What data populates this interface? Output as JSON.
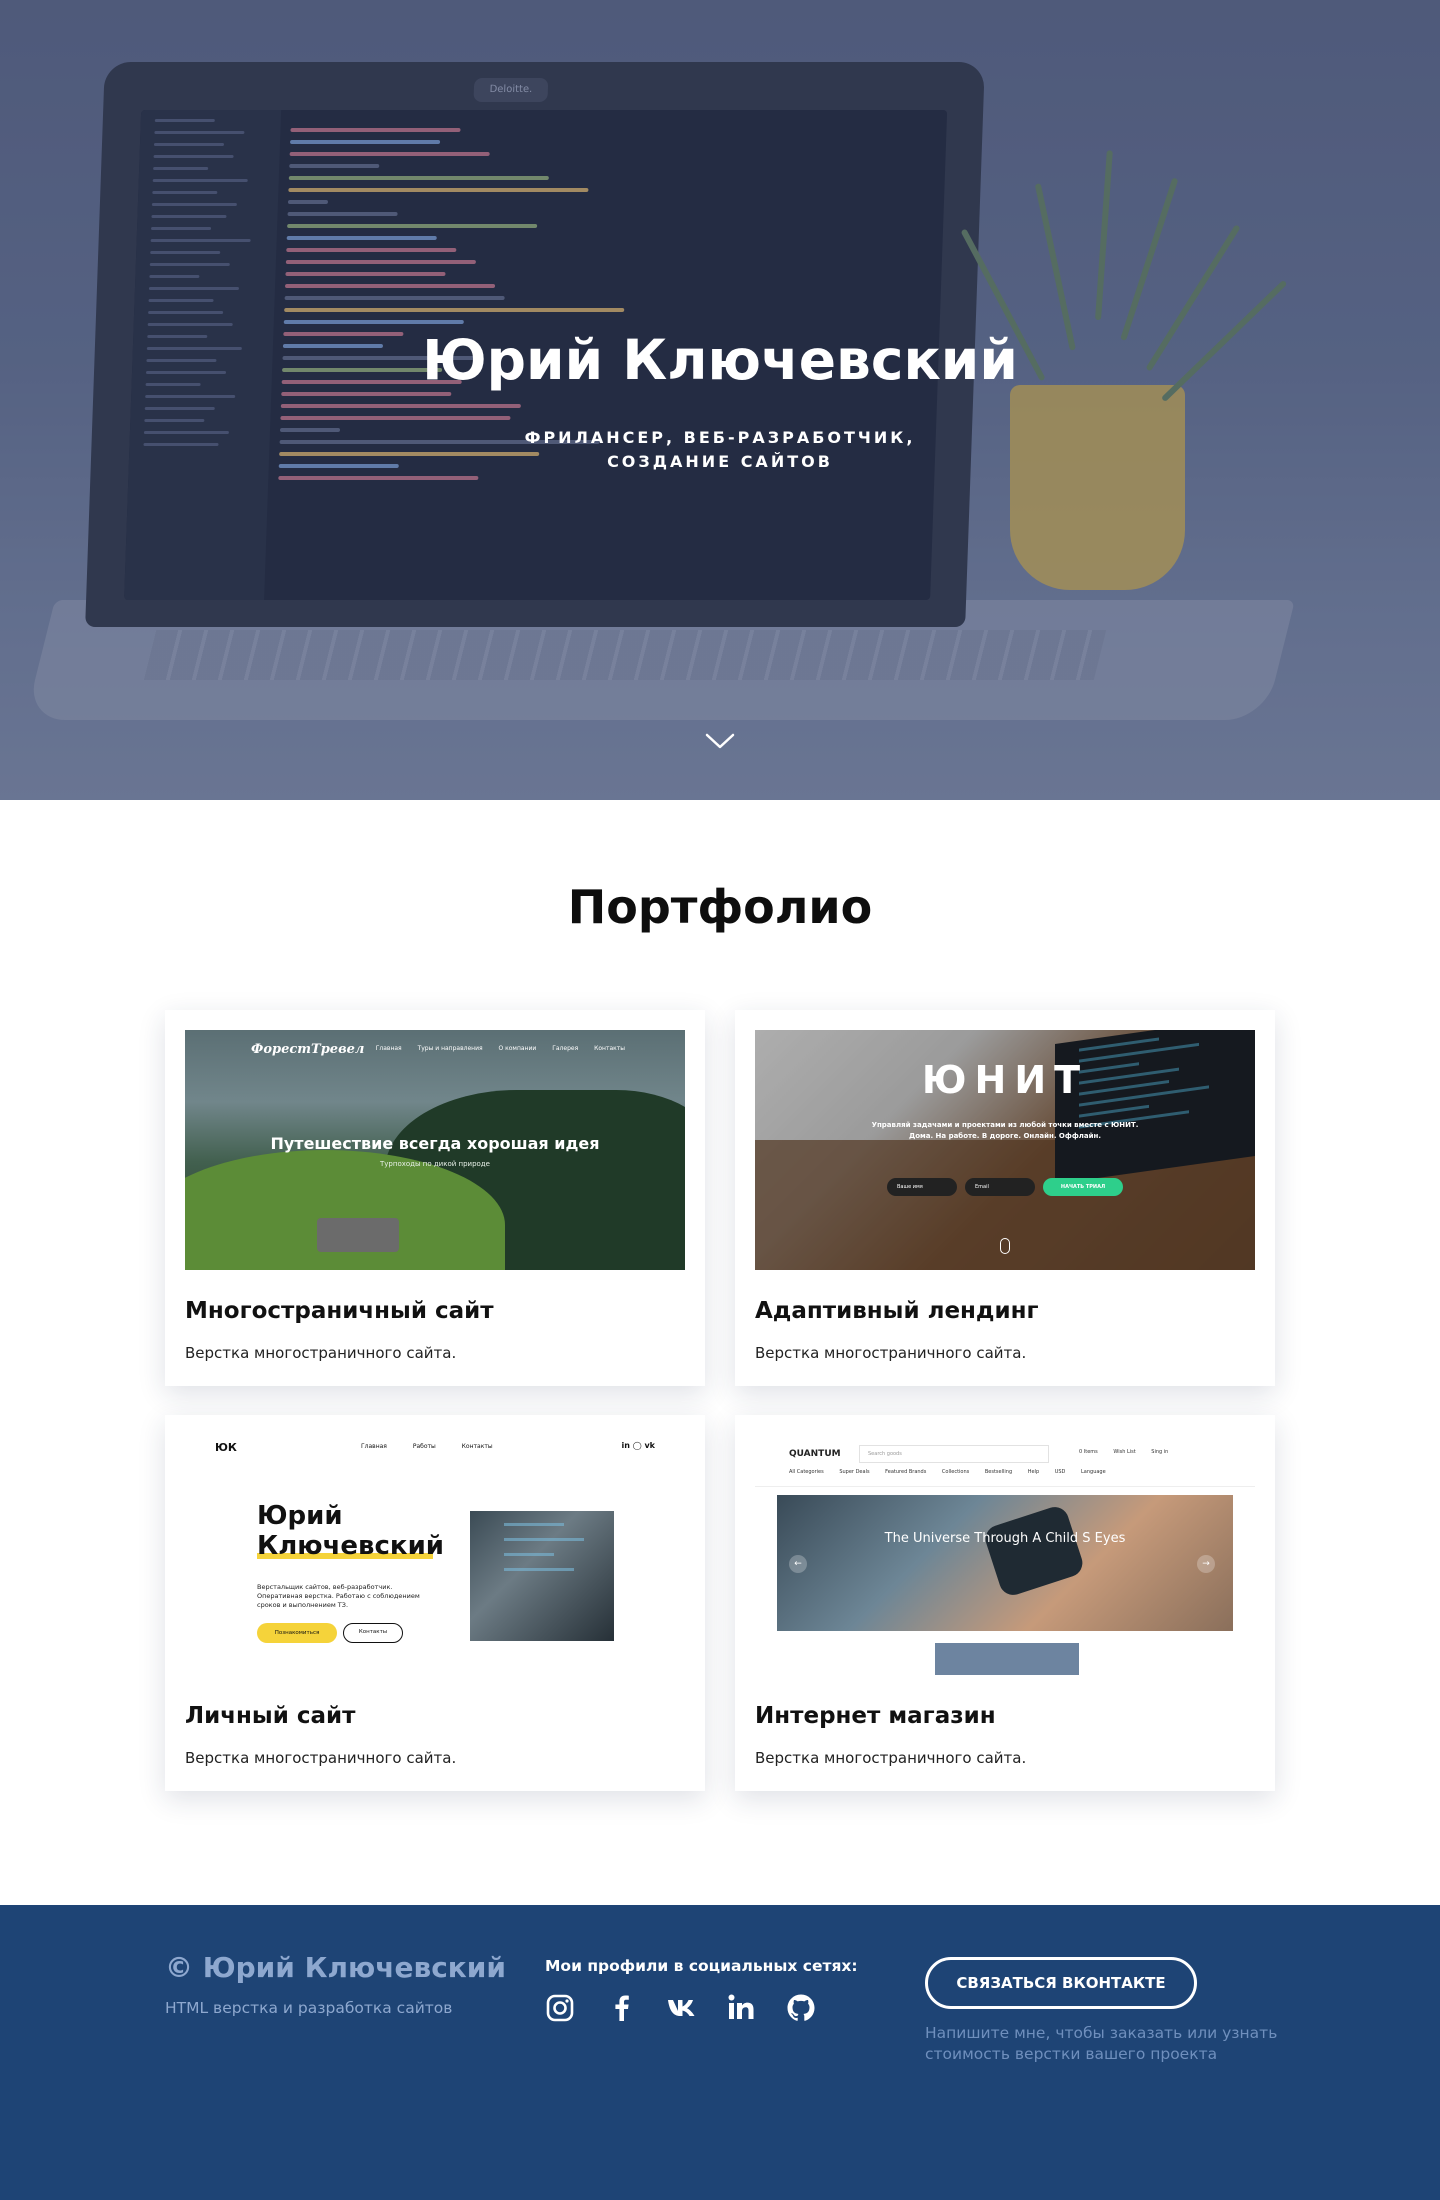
{
  "hero": {
    "title": "Юрий Ключевский",
    "subtitle_line1": "ФРИЛАНСЕР, ВЕБ-РАЗРАБОТЧИК,",
    "subtitle_line2": "СОЗДАНИЕ САЙТОВ",
    "laptop_brand": "Deloitte.",
    "scroll_icon": "chevron-down-icon"
  },
  "portfolio": {
    "title": "Портфолио",
    "cards": [
      {
        "title": "Многостраничный сайт",
        "desc": "Верстка многостраничного сайта.",
        "thumb": {
          "logo": "ФорестТревел",
          "nav": [
            "Главная",
            "Туры и направления",
            "О компании",
            "Галерея",
            "Контакты"
          ],
          "heading": "Путешествие всегда хорошая идея",
          "sub": "Турпоходы по дикой природе"
        }
      },
      {
        "title": "Адаптивный лендинг",
        "desc": "Верстка многостраничного сайта.",
        "thumb": {
          "brand": "ЮНИТ",
          "sub1": "Управляй задачами и проектами из любой точки вместе с ЮНИТ.",
          "sub2": "Дома. На работе. В дороге. Онлайн. Оффлайн.",
          "input1": "Ваше имя",
          "input2": "Email",
          "cta": "НАЧАТЬ ТРИАЛ"
        }
      },
      {
        "title": "Личный сайт",
        "desc": "Верстка многостраничного сайта.",
        "thumb": {
          "logo": "ЮК",
          "nav": [
            "Главная",
            "Работы",
            "Контакты"
          ],
          "social": "in ◯ vk",
          "name_line1": "Юрий",
          "name_line2": "Ключевский",
          "desc": "Верстальщик сайтов, веб-разработчик. Оперативная верстка. Работаю с соблюдением сроков и выполнением ТЗ.",
          "btn1": "Познакомиться",
          "btn2": "Контакты"
        }
      },
      {
        "title": "Интернет магазин",
        "desc": "Верстка многостраничного сайта.",
        "thumb": {
          "logo": "QUANTUM",
          "search": "Search goods",
          "actions": [
            "0 Items",
            "Wish List",
            "Sing in"
          ],
          "menu": [
            "All Categories",
            "Super Deals",
            "Featured Brands",
            "Collections",
            "Bestselling",
            "Help",
            "USD",
            "Language"
          ],
          "slide_title": "The Universe Through A Child S Eyes",
          "arrow_left": "←",
          "arrow_right": "→"
        }
      }
    ]
  },
  "footer": {
    "name": "© Юрий Ключевский",
    "tagline": "HTML верстка и разработка сайтов",
    "social_label": "Мои профили в социальных сетях:",
    "social_icons": [
      "instagram-icon",
      "facebook-icon",
      "vk-icon",
      "linkedin-icon",
      "github-icon"
    ],
    "button": "СВЯЗАТЬСЯ ВКОНТАКТЕ",
    "note": "Напишите мне, чтобы заказать или узнать стоимость верстки вашего проекта"
  },
  "colors": {
    "footer_bg": "#1e4475",
    "accent_yellow": "#f5d33a",
    "accent_green": "#2ecf8b"
  }
}
